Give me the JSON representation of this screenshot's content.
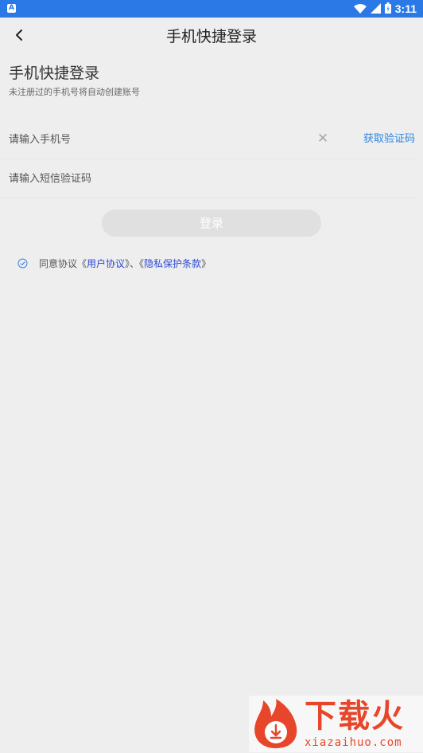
{
  "status_bar": {
    "app_badge": "A",
    "time": "3:11"
  },
  "header": {
    "title": "手机快捷登录"
  },
  "main": {
    "heading": "手机快捷登录",
    "subheading": "未注册过的手机号将自动创建账号",
    "phone_input": {
      "placeholder": "请输入手机号",
      "value": ""
    },
    "clear_symbol": "✕",
    "get_code_label": "获取验证码",
    "code_input": {
      "placeholder": "请输入短信验证码",
      "value": ""
    },
    "login_label": "登录"
  },
  "agreement": {
    "prefix": "同意协议《",
    "user_agreement": "用户协议",
    "separator": "》、《",
    "privacy": "隐私保护条款",
    "suffix": "》"
  },
  "watermark": {
    "cn": "下载火",
    "en": "xiazaihuo.com"
  },
  "colors": {
    "status_bar": "#2b79e6",
    "accent": "#2e86de",
    "link": "#2a49d4",
    "button_disabled": "#e0e0e0",
    "watermark": "#e8462a"
  },
  "icons": [
    "app-icon",
    "wifi-icon",
    "signal-icon",
    "battery-icon",
    "back-arrow-icon",
    "clear-icon",
    "check-circle-icon",
    "logo-icon"
  ]
}
